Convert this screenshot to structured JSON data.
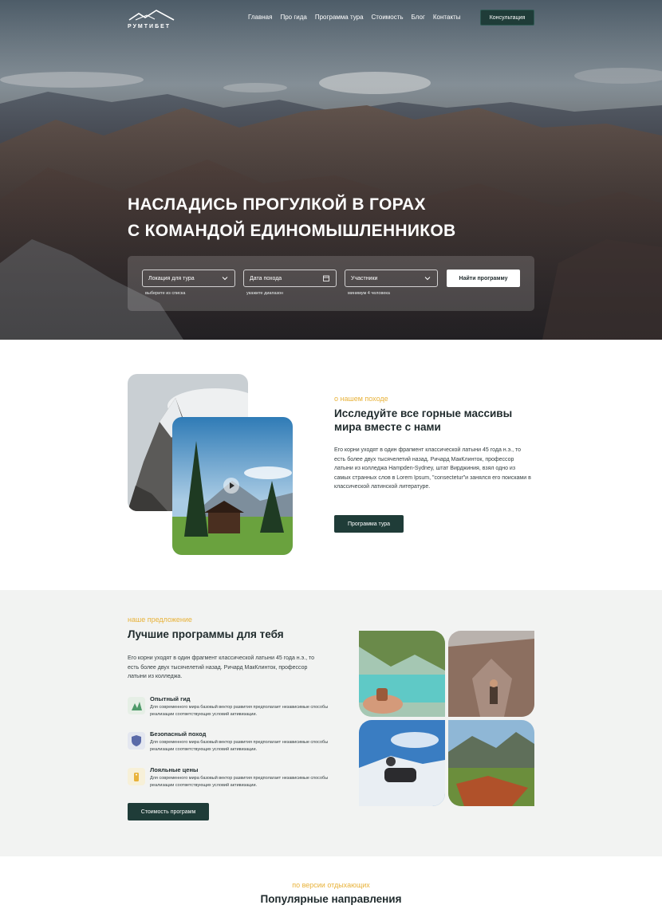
{
  "brand": {
    "name": "РУМТИБЕТ"
  },
  "nav": {
    "items": [
      "Главная",
      "Про гида",
      "Программа тура",
      "Стоимость",
      "Блог",
      "Контакты"
    ],
    "cta": "Консультация"
  },
  "hero": {
    "title_line1": "НАСЛАДИСЬ ПРОГУЛКОЙ В ГОРАХ",
    "title_line2": "С КОМАНДОЙ ЕДИНОМЫШЛЕННИКОВ",
    "search": {
      "location": {
        "label": "Локация для тура",
        "hint": "выберите из списка"
      },
      "date": {
        "label": "Дата похода",
        "hint": "укажите диапазон"
      },
      "participants": {
        "label": "Участники",
        "hint": "минимум 4 человека"
      },
      "button": "Найти программу"
    }
  },
  "about": {
    "kicker": "о нашем походе",
    "title_line1": "Исследуйте все горные массивы",
    "title_line2": "мира вместе с нами",
    "text": "Его корни уходят в один фрагмент классической латыни 45 года н.э., то есть более двух тысячелетий назад. Ричард МакКлинток, профессор латыни из колледжа Hampden-Sydney, штат Вирджиния, взял одно из самых странных слов в Lorem Ipsum, \"consectetur\"и занялся его поисками в классической латинской литературе.",
    "button": "Программа тура"
  },
  "offer": {
    "kicker": "наше предложение",
    "title": "Лучшие программы для тебя",
    "text": "Его корни уходят в один фрагмент классической латыни 45 года н.э., то есть более двух тысячелетий назад. Ричард МакКлинток, профессор латыни из колледжа.",
    "features": [
      {
        "title": "Опытный гид",
        "desc": "Для современного мира базовый вектор развития предполагает независимые способы реализации соответствующих условий активизации."
      },
      {
        "title": "Безопасный поход",
        "desc": "Для современного мира базовый вектор развития предполагает независимые способы реализации соответствующих условий активизации."
      },
      {
        "title": "Лояльные цены",
        "desc": "Для современного мира базовый вектор развития предполагает независимые способы реализации соответствующих условий активизации."
      }
    ],
    "button": "Стоимость программ"
  },
  "popular": {
    "kicker": "по версии отдыхающих",
    "title": "Популярные направления"
  },
  "colors": {
    "accent": "#e8b23a",
    "dark": "#1f3c38",
    "offer_bg": "#f2f3f2"
  }
}
